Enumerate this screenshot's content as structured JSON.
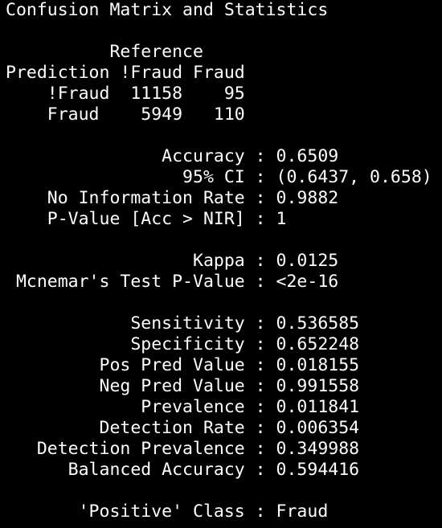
{
  "console": {
    "background": "#000000",
    "foreground": "#ffffff",
    "lines": [
      "Confusion Matrix and Statistics",
      "",
      "          Reference",
      "Prediction !Fraud Fraud",
      "    !Fraud  11158    95",
      "    Fraud    5949   110",
      "",
      "               Accuracy : 0.6509",
      "                 95% CI : (0.6437, 0.658)",
      "    No Information Rate : 0.9882",
      "    P-Value [Acc > NIR] : 1",
      "",
      "                  Kappa : 0.0125",
      " Mcnemar's Test P-Value : <2e-16",
      "",
      "            Sensitivity : 0.536585",
      "            Specificity : 0.652248",
      "         Pos Pred Value : 0.018155",
      "         Neg Pred Value : 0.991558",
      "             Prevalence : 0.011841",
      "         Detection Rate : 0.006354",
      "   Detection Prevalence : 0.349988",
      "      Balanced Accuracy : 0.594416",
      "",
      "       'Positive' Class : Fraud"
    ]
  }
}
